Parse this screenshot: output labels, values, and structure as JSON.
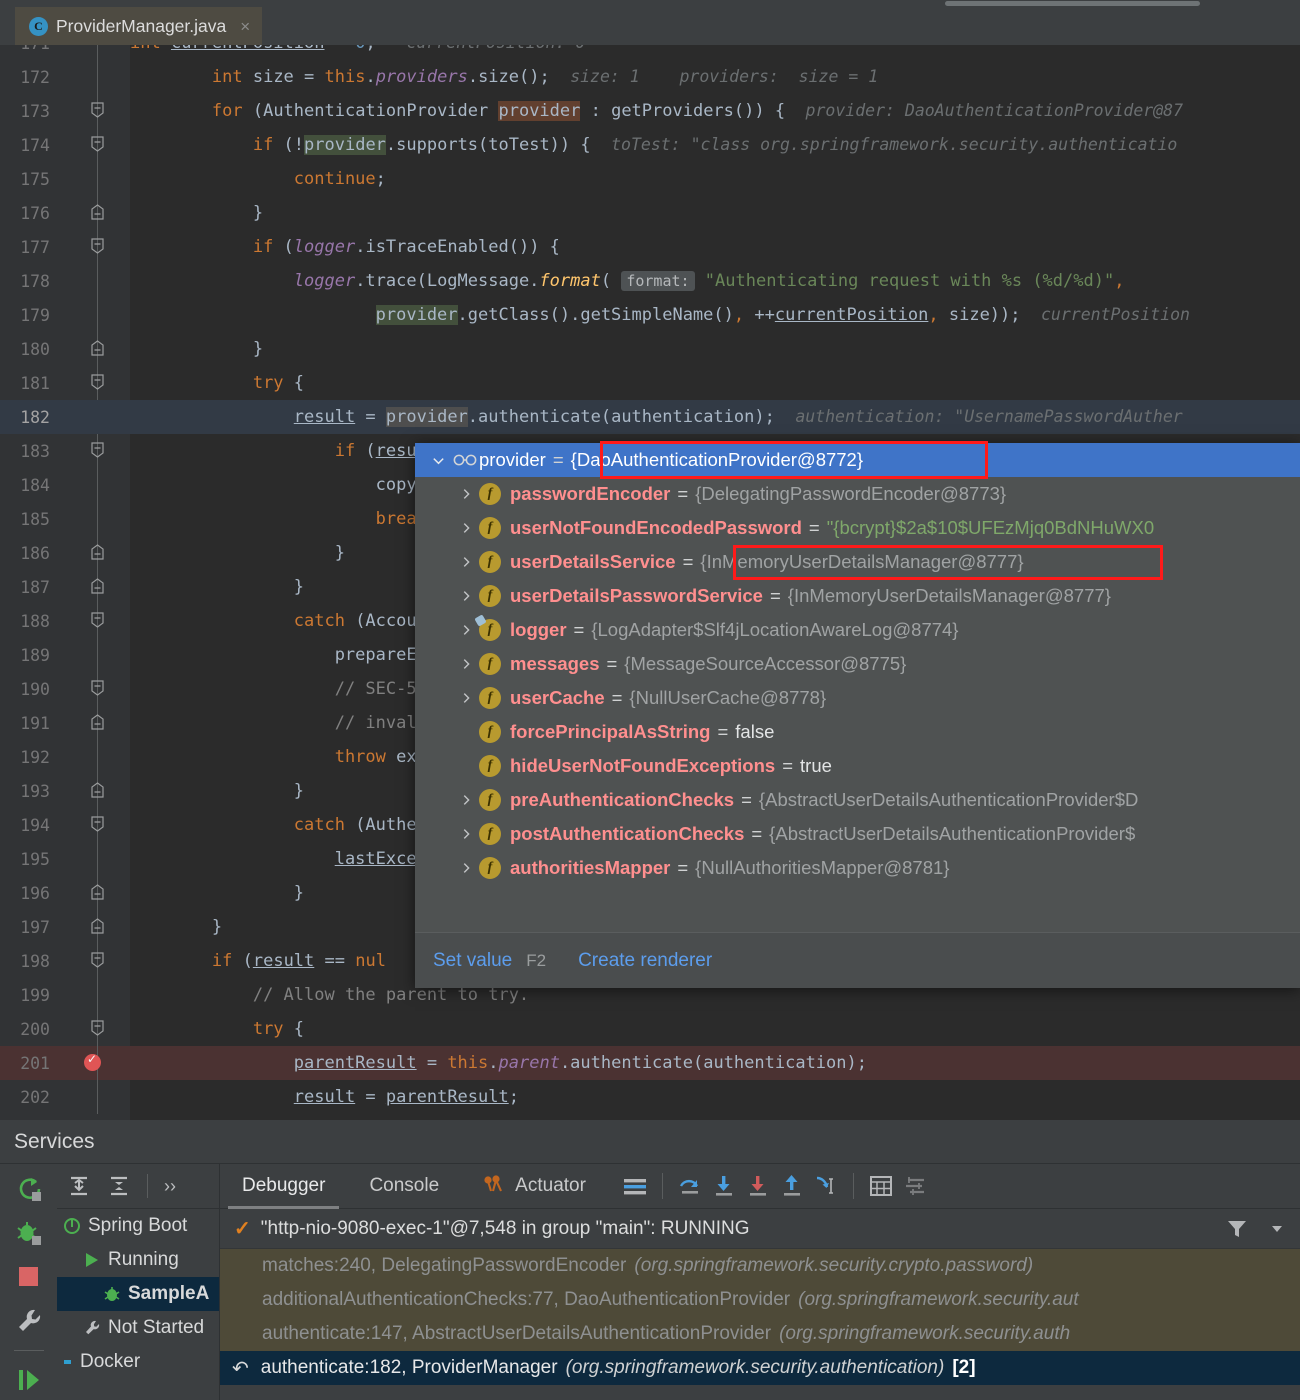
{
  "editor_tab": {
    "icon": "java-class-icon",
    "title": "ProviderManager.java",
    "close": "×"
  },
  "code": {
    "lines": [
      {
        "num": "171",
        "partial": true
      },
      {
        "num": "172"
      },
      {
        "num": "173"
      },
      {
        "num": "174"
      },
      {
        "num": "175"
      },
      {
        "num": "176"
      },
      {
        "num": "177"
      },
      {
        "num": "178"
      },
      {
        "num": "179"
      },
      {
        "num": "180"
      },
      {
        "num": "181"
      },
      {
        "num": "182"
      },
      {
        "num": "183"
      },
      {
        "num": "184"
      },
      {
        "num": "185"
      },
      {
        "num": "186"
      },
      {
        "num": "187"
      },
      {
        "num": "188"
      },
      {
        "num": "189"
      },
      {
        "num": "190"
      },
      {
        "num": "191"
      },
      {
        "num": "192"
      },
      {
        "num": "193"
      },
      {
        "num": "194"
      },
      {
        "num": "195"
      },
      {
        "num": "196"
      },
      {
        "num": "197"
      },
      {
        "num": "198"
      },
      {
        "num": "199"
      },
      {
        "num": "200"
      },
      {
        "num": "201"
      },
      {
        "num": "202"
      }
    ],
    "hints": {
      "size_hint": "size: 1",
      "providers_hint": "providers:  size = 1",
      "provider_hint": "provider: DaoAuthenticationProvider@87",
      "totest_hint": "toTest: \"class org.springframework.security.authenticatio",
      "format_label": "format:",
      "currentposition_hint": "currentPosition",
      "authentication_hint": "authentication: \"UsernamePasswordAuther"
    }
  },
  "popup": {
    "root": {
      "icon": "watches-glasses-icon",
      "name": "provider",
      "value": "{DaoAuthenticationProvider@8772}"
    },
    "fields": [
      {
        "name": "passwordEncoder",
        "value": "{DelegatingPasswordEncoder@8773}",
        "kind": "obj",
        "expandable": true
      },
      {
        "name": "userNotFoundEncodedPassword",
        "value": "\"{bcrypt}$2a$10$UFEzMjq0BdNHuWX0",
        "kind": "str",
        "expandable": true
      },
      {
        "name": "userDetailsService",
        "value": "{InMemoryUserDetailsManager@8777}",
        "kind": "obj",
        "expandable": true
      },
      {
        "name": "userDetailsPasswordService",
        "value": "{InMemoryUserDetailsManager@8777}",
        "kind": "obj",
        "expandable": true
      },
      {
        "name": "logger",
        "value": "{LogAdapter$Slf4jLocationAwareLog@8774}",
        "kind": "obj",
        "expandable": true,
        "wrapped": true
      },
      {
        "name": "messages",
        "value": "{MessageSourceAccessor@8775}",
        "kind": "obj",
        "expandable": true
      },
      {
        "name": "userCache",
        "value": "{NullUserCache@8778}",
        "kind": "obj",
        "expandable": true
      },
      {
        "name": "forcePrincipalAsString",
        "value": "false",
        "kind": "lit",
        "expandable": false
      },
      {
        "name": "hideUserNotFoundExceptions",
        "value": "true",
        "kind": "lit",
        "expandable": false
      },
      {
        "name": "preAuthenticationChecks",
        "value": "{AbstractUserDetailsAuthenticationProvider$D",
        "kind": "obj",
        "expandable": true
      },
      {
        "name": "postAuthenticationChecks",
        "value": "{AbstractUserDetailsAuthenticationProvider$",
        "kind": "obj",
        "expandable": true
      },
      {
        "name": "authoritiesMapper",
        "value": "{NullAuthoritiesMapper@8781}",
        "kind": "obj",
        "expandable": true
      }
    ],
    "actions": {
      "set_value": "Set value",
      "set_value_shortcut": "F2",
      "create_renderer": "Create renderer"
    }
  },
  "services": {
    "title": "Services",
    "rail_icons": [
      "rerun-icon",
      "debug-icon",
      "stop-icon",
      "settings-wrench-icon",
      "resume-icon"
    ],
    "tree_toolbar": [
      "expand-all-icon",
      "collapse-all-icon",
      "more-icon"
    ],
    "more_label": "››",
    "tree": [
      {
        "label": "Spring Boot",
        "icon": "spring-boot-icon",
        "selected": false,
        "depth": 0
      },
      {
        "label": "Running",
        "icon": "run-triangle-icon",
        "selected": false,
        "depth": 1
      },
      {
        "label": "SampleA",
        "icon": "debug-bug-icon",
        "selected": true,
        "depth": 2
      },
      {
        "label": "Not Started",
        "icon": "wrench-icon",
        "selected": false,
        "depth": 1
      },
      {
        "label": "Docker",
        "icon": "docker-icon",
        "selected": false,
        "depth": 0
      }
    ],
    "tabs": [
      {
        "label": "Debugger",
        "active": true,
        "icon": null
      },
      {
        "label": "Console",
        "active": false,
        "icon": null
      },
      {
        "label": "Actuator",
        "active": false,
        "icon": "actuator-icon"
      }
    ],
    "toolbar_icons": [
      "threads-view-icon",
      "step-over-icon",
      "step-into-icon",
      "force-step-into-icon",
      "step-out-icon",
      "run-to-cursor-icon",
      "evaluate-expression-icon",
      "settings-list-icon"
    ],
    "thread": {
      "status_icon": "check-icon",
      "label": "\"http-nio-9080-exec-1\"@7,548 in group \"main\": RUNNING",
      "filter_icon": "filter-icon",
      "dropdown_icon": "chevron-down-icon"
    },
    "frames": [
      {
        "method": "matches:240, DelegatingPasswordEncoder",
        "pkg": "(org.springframework.security.crypto.password)",
        "selected": false,
        "count": ""
      },
      {
        "method": "additionalAuthenticationChecks:77, DaoAuthenticationProvider",
        "pkg": "(org.springframework.security.aut",
        "selected": false,
        "count": ""
      },
      {
        "method": "authenticate:147, AbstractUserDetailsAuthenticationProvider",
        "pkg": "(org.springframework.security.auth",
        "selected": false,
        "count": ""
      },
      {
        "method": "authenticate:182, ProviderManager",
        "pkg": "(org.springframework.security.authentication)",
        "selected": true,
        "count": "[2]",
        "icon": "step-back-icon"
      }
    ]
  },
  "colors": {
    "accent_blue": "#3f74c8",
    "annotation_red": "#ff1a1a",
    "selection_navy": "#0d293e",
    "editor_bg": "#2b2b2b",
    "popup_bg": "#4f5252",
    "keyword_orange": "#cc7832",
    "string_green": "#6a8759",
    "field_purple": "#9876aa",
    "name_pink": "#ff8f8f"
  }
}
